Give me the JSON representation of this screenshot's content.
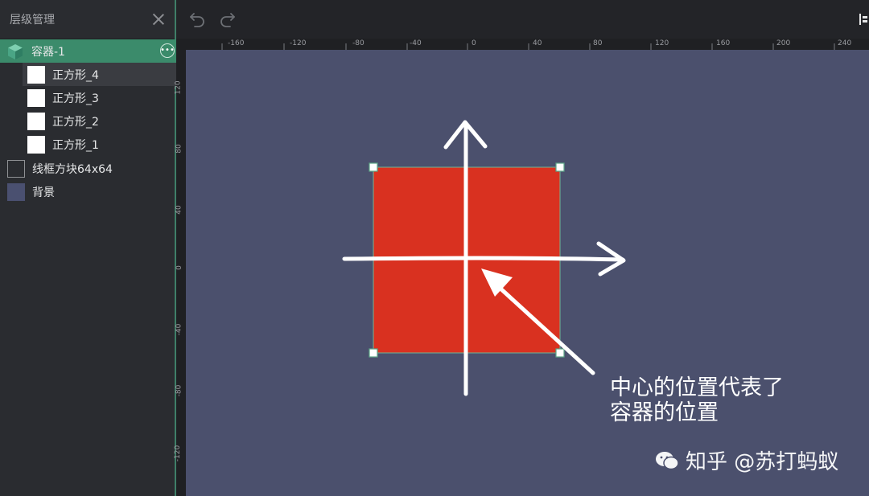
{
  "panel": {
    "title": "层级管理",
    "items": [
      {
        "label": "容器-1",
        "kind": "container"
      },
      {
        "label": "正方形_4",
        "kind": "square"
      },
      {
        "label": "正方形_3",
        "kind": "square"
      },
      {
        "label": "正方形_2",
        "kind": "square"
      },
      {
        "label": "正方形_1",
        "kind": "square"
      },
      {
        "label": "线框方块64x64",
        "kind": "outline"
      },
      {
        "label": "背景",
        "kind": "background"
      }
    ]
  },
  "toolbar": {
    "undo": "undo-icon",
    "redo": "redo-icon"
  },
  "ruler": {
    "top_labels": [
      "-160",
      "-120",
      "-80",
      "-40",
      "0",
      "40",
      "80",
      "120",
      "160",
      "200",
      "240"
    ],
    "left_labels": [
      "120",
      "80",
      "40",
      "0",
      "-40",
      "-80",
      "-120"
    ]
  },
  "annotation": {
    "line1": "中心的位置代表了",
    "line2": "容器的位置"
  },
  "watermark": {
    "text": "知乎 @苏打蚂蚁"
  },
  "colors": {
    "accent": "#3b8b6b",
    "canvas": "#4b506d",
    "square": "#d93120"
  }
}
